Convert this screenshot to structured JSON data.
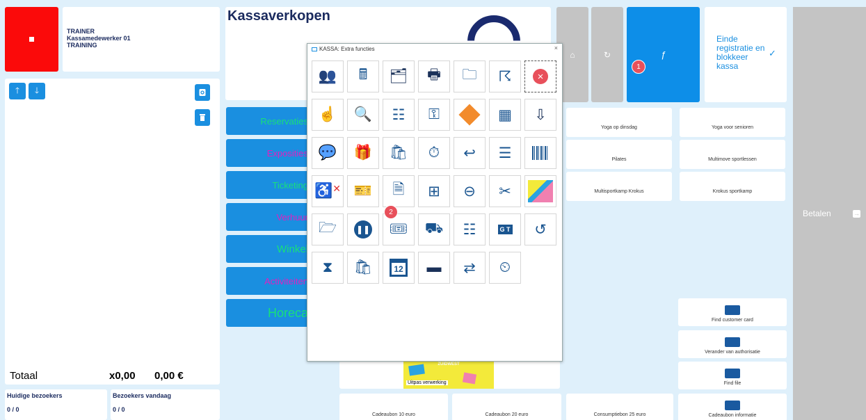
{
  "user": {
    "role": "TRAINER",
    "name": "Kassamedewerker 01",
    "mode": "TRAINING"
  },
  "header": {
    "title": "Kassaverkopen"
  },
  "totals": {
    "label": "Totaal",
    "quantity": "x0,00",
    "amount": "0,00 €"
  },
  "visitors": {
    "current_label": "Huidige bezoekers",
    "current_value": "0 / 0",
    "today_label": "Bezoekers vandaag",
    "today_value": "0 / 0"
  },
  "categories": [
    {
      "label": "Reservaties",
      "color": "#18e07a"
    },
    {
      "label": "Exposities",
      "color": "#e020c0"
    },
    {
      "label": "Ticketing",
      "color": "#18e07a"
    },
    {
      "label": "Verhuur",
      "color": "#e020c0"
    },
    {
      "label": "Winkel",
      "color": "#18e07a"
    },
    {
      "label": "Activiteiten",
      "color": "#e020c0"
    },
    {
      "label": "Horeca",
      "color": "#18e07a"
    }
  ],
  "toolbar": {
    "einde_label": "Einde registratie en blokkeer kassa",
    "betalen_label": "Betalen",
    "func_symbol": "ƒ"
  },
  "products": [
    "Yoga op dinsdag",
    "Yoga voor senioren",
    "Pilates",
    "Multimove sportlessen",
    "Multisportkamp Krokus",
    "Krokus sportkamp"
  ],
  "right_actions": [
    "Find customer card",
    "Verander van authorisatie",
    "Find file",
    "Cadeaubon informatie"
  ],
  "bottom_products": [
    "Cadeaubon 10 euro",
    "Cadeaubon 20 euro",
    "Consumptiebon 25 euro"
  ],
  "uitpas": {
    "label": "Uitpas verwerking",
    "banner": "ZUIDWEST"
  },
  "dialog": {
    "title": "KASSA: Extra functies",
    "close": "×"
  },
  "badges": {
    "one": "1",
    "two": "2"
  },
  "accent": "#1a8fe0",
  "icons": [
    "users-icon",
    "cash-register-icon",
    "contact-folder-icon",
    "printer-icon",
    "folder-search-icon",
    "fingerprint-icon",
    "close-red-icon",
    "hand-pointer-icon",
    "search-icon",
    "list-icon",
    "key-icon",
    "ticket-diamond-icon",
    "calendar-icon",
    "folder-download-icon",
    "chat-icon",
    "gift-box-icon",
    "bag-search-icon",
    "timer-icon",
    "user-return-icon",
    "receipt-list-icon",
    "barcode-icon",
    "seat-cancel-icon",
    "voucher-icon",
    "document-search-icon",
    "calendar-plus-icon",
    "user-remove-icon",
    "cut-voucher-icon",
    "uitpas-card-icon",
    "folder-search-alt-icon",
    "pause-icon",
    "ticket-icon",
    "delivery-time-icon",
    "list-alt-icon",
    "gt-icon",
    "refresh-face-icon",
    "bag-hourglass-icon",
    "bag-search-alt-icon",
    "calendar-12-icon",
    "wallet-icon",
    "swap-screen-icon",
    "timer-plus-icon"
  ]
}
